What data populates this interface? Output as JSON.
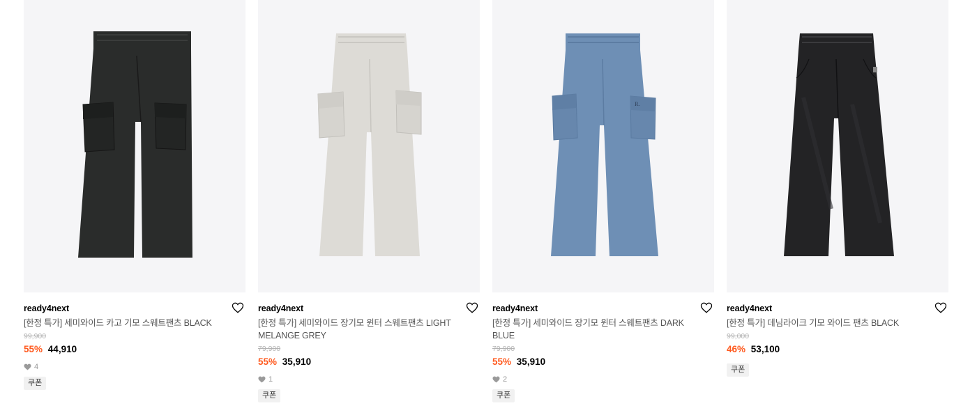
{
  "products": [
    {
      "brand": "ready4next",
      "title": "[한정 특가] 세미와이드 카고 기모 스웨트팬츠 BLACK",
      "original_price": "99,900",
      "discount": "55%",
      "price": "44,910",
      "likes": "4",
      "coupon": "쿠폰",
      "color": "#2a2c2b",
      "style": "cargo"
    },
    {
      "brand": "ready4next",
      "title": "[한정 특가] 세미와이드 장기모 윈터 스웨트팬츠 LIGHT MELANGE GREY",
      "original_price": "79,900",
      "discount": "55%",
      "price": "35,910",
      "likes": "1",
      "coupon": "쿠폰",
      "color": "#dddbd6",
      "style": "cargo"
    },
    {
      "brand": "ready4next",
      "title": "[한정 특가] 세미와이드 장기모 윈터 스웨트팬츠 DARK BLUE",
      "original_price": "79,900",
      "discount": "55%",
      "price": "35,910",
      "likes": "2",
      "coupon": "쿠폰",
      "color": "#6e8fb5",
      "style": "cargo"
    },
    {
      "brand": "ready4next",
      "title": "[한정 특가] 데님라이크 기모 와이드 팬츠 BLACK",
      "original_price": "99,000",
      "discount": "46%",
      "price": "53,100",
      "likes": "",
      "coupon": "쿠폰",
      "color": "#232325",
      "style": "denim"
    }
  ]
}
